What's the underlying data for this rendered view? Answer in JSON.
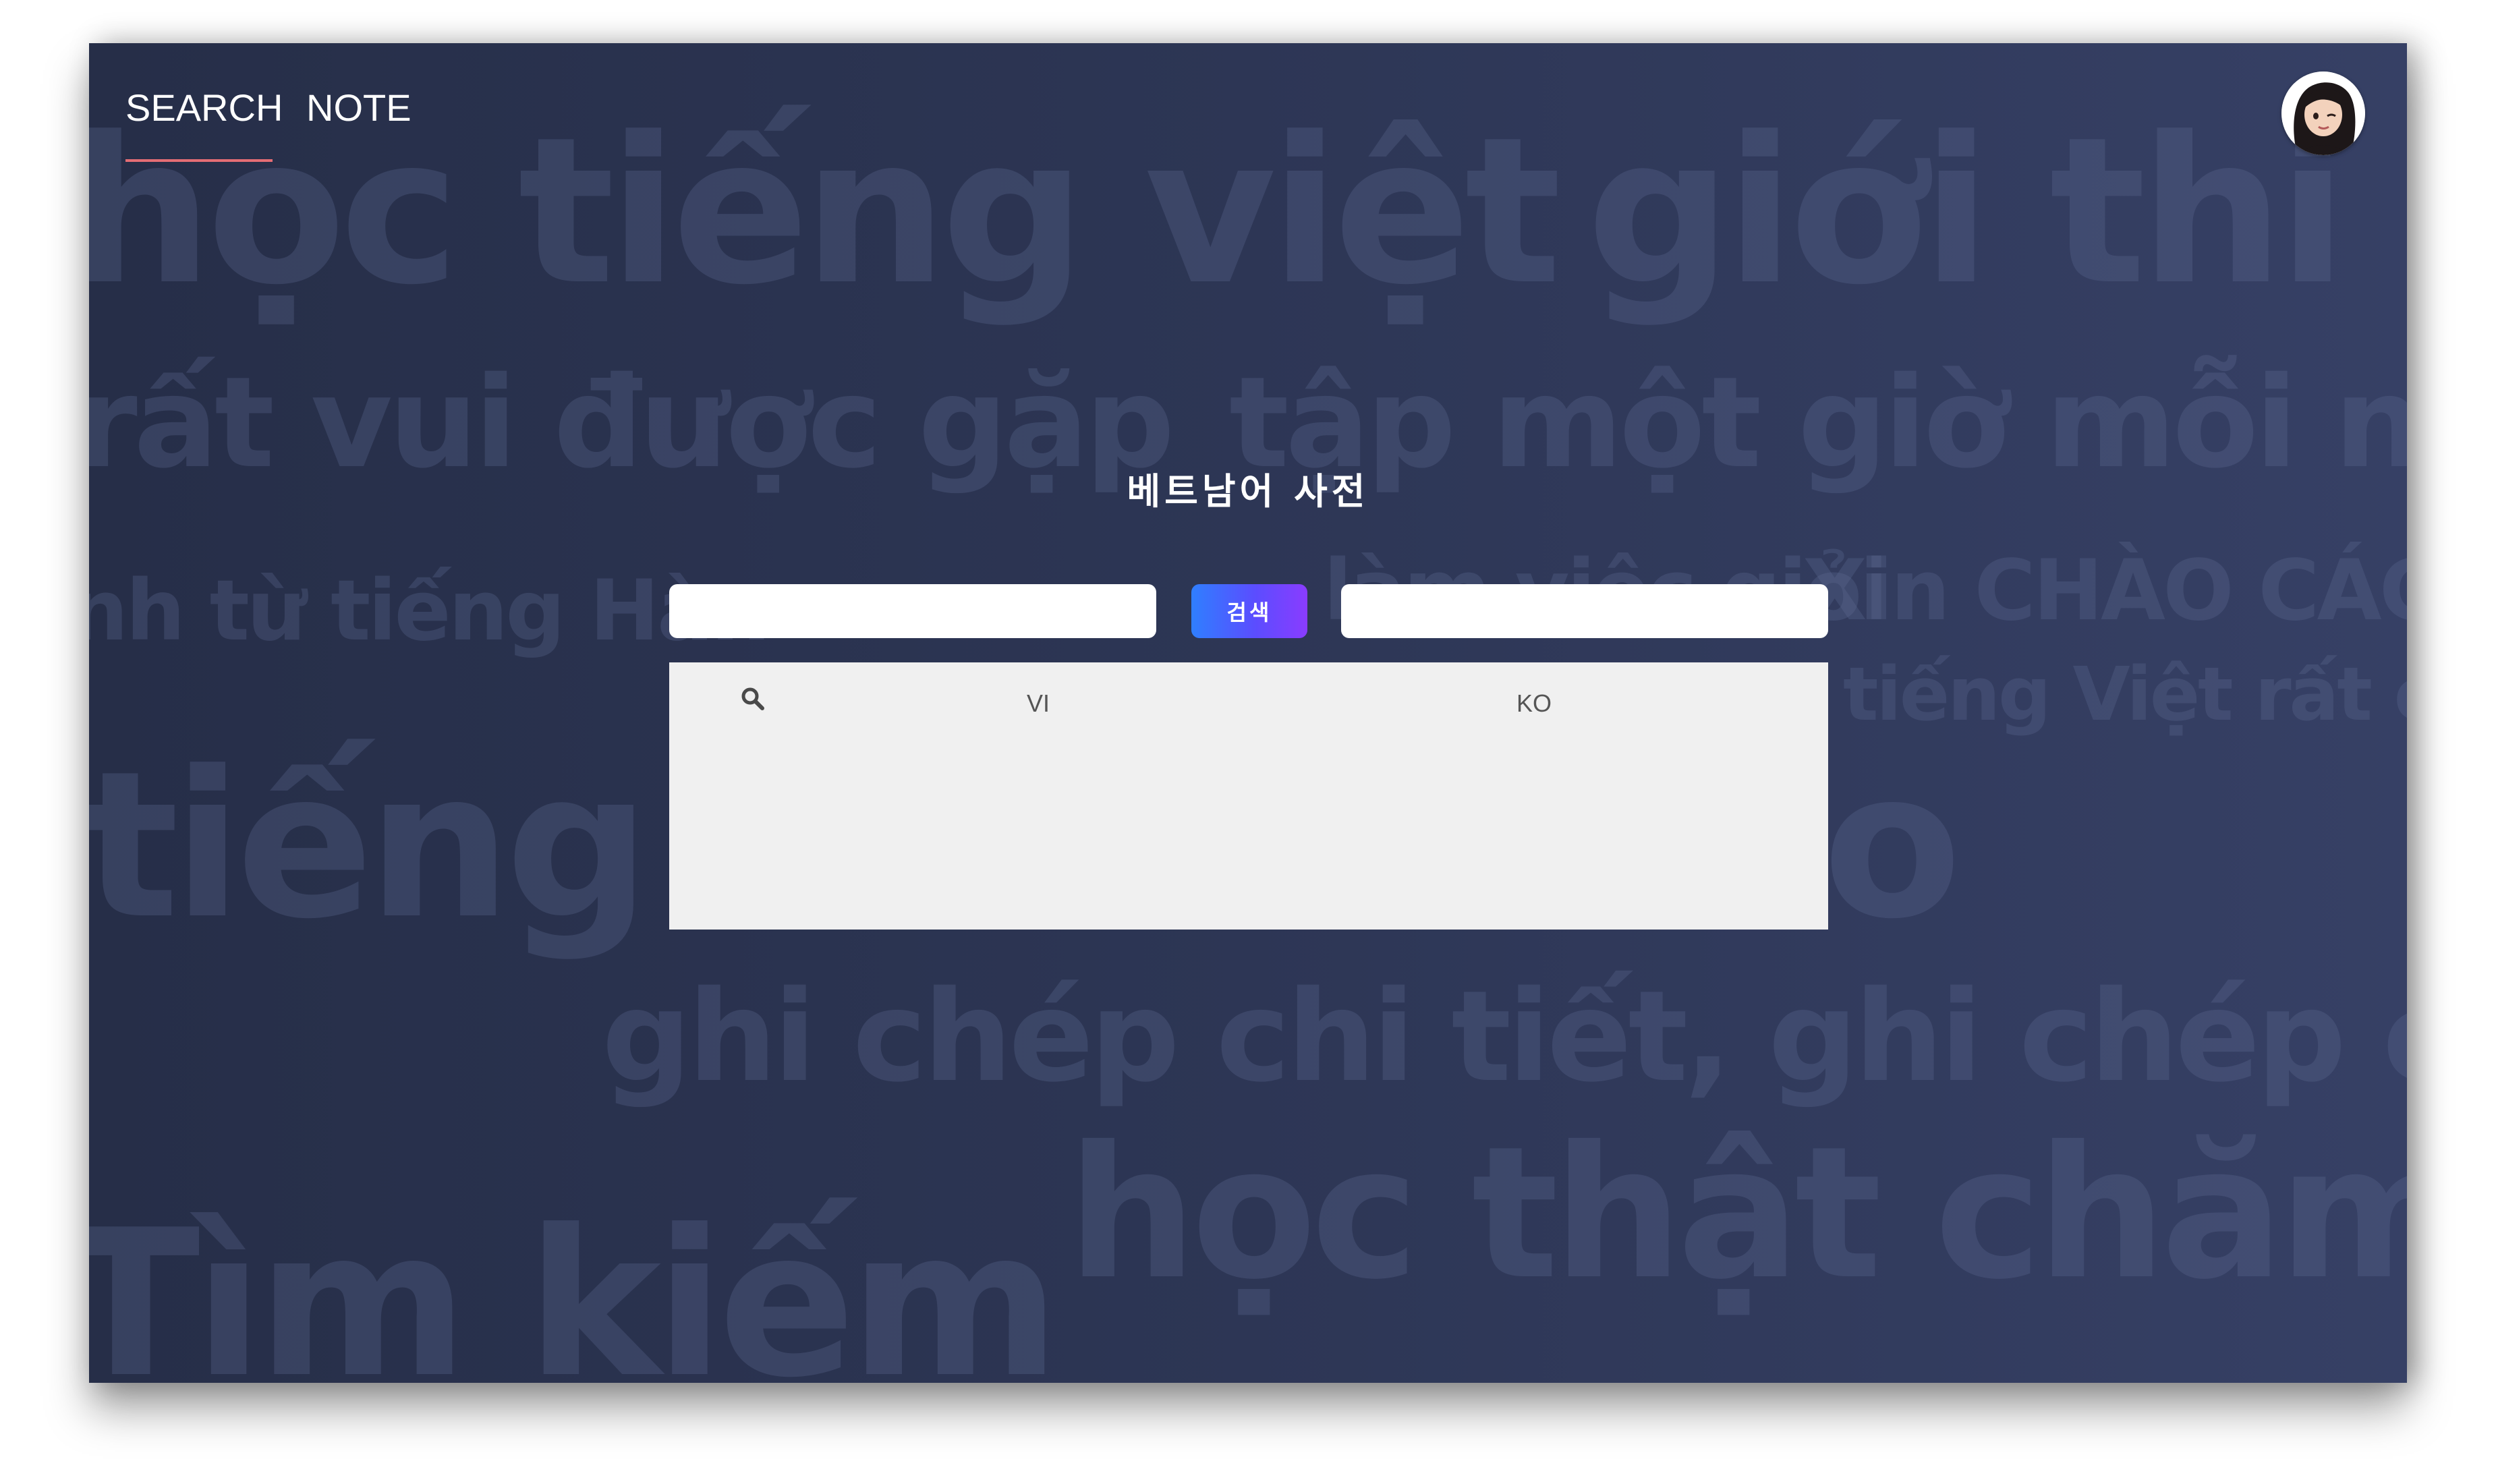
{
  "nav": {
    "tabs": [
      {
        "label": "SEARCH",
        "active": true
      },
      {
        "label": "NOTE",
        "active": false
      }
    ],
    "active_underline_color": "#e46d74"
  },
  "avatar": {
    "icon": "user-memoji-avatar-icon"
  },
  "main": {
    "title": "베트남어 사전",
    "source_input": {
      "value": "",
      "placeholder": ""
    },
    "search_button_label": "검색",
    "target_input": {
      "value": "",
      "placeholder": ""
    }
  },
  "results": {
    "search_icon": "magnifier-icon",
    "columns": [
      "VI",
      "KO"
    ],
    "rows": []
  },
  "background_words": [
    "học tiếng việt",
    "giới thi",
    "rất vui được gặp",
    "tập một giờ mỗi n",
    "nh từ tiếng Hàn",
    "làm việc giỏi",
    "Xin CHÀO CÁC B",
    "tiếng Việt rất chuẩ",
    "tiếng V",
    "o",
    "ghi chép chi tiết, ghi chép cụ th",
    "học thật chăm c",
    "Tìm kiếm"
  ],
  "colors": {
    "app_bg_left": "#262e48",
    "app_bg_right": "#364065",
    "button_gradient_start": "#2f7fff",
    "button_gradient_end": "#8a3cff",
    "panel_bg": "#f0f0f0"
  }
}
